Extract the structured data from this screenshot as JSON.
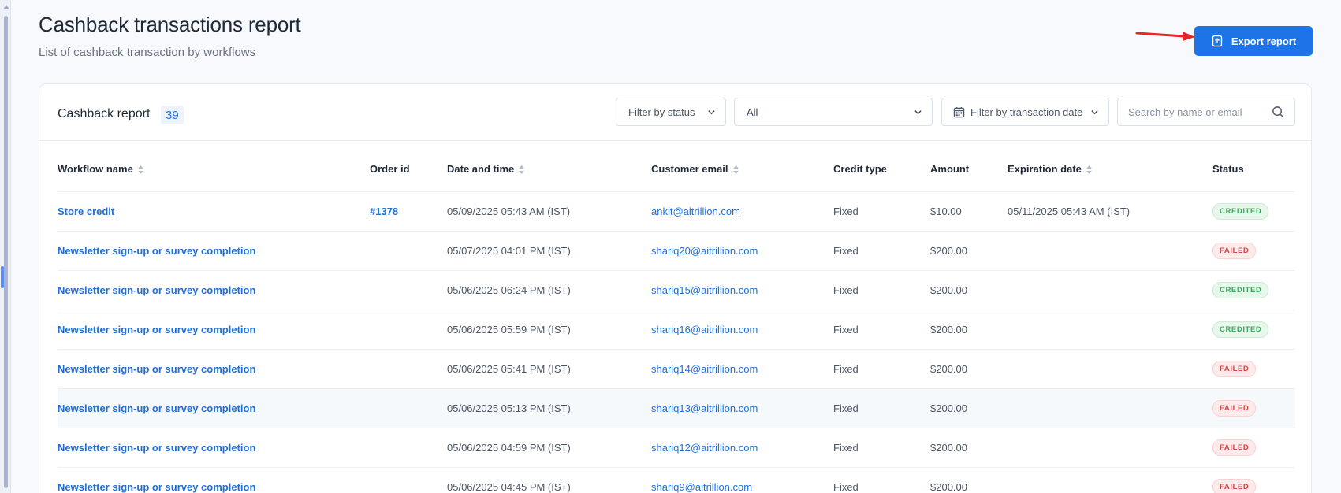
{
  "page": {
    "title": "Cashback transactions report",
    "subtitle": "List of cashback transaction by workflows",
    "export_label": "Export report"
  },
  "report": {
    "title": "Cashback report",
    "count": "39",
    "filters": {
      "status_label": "Filter by status",
      "selected_value": "All",
      "date_label": "Filter by transaction date",
      "search_placeholder": "Search by name or email"
    },
    "columns": [
      "Workflow name",
      "Order id",
      "Date and time",
      "Customer email",
      "Credit type",
      "Amount",
      "Expiration date",
      "Status"
    ],
    "rows": [
      {
        "workflow": "Store credit",
        "order": "#1378",
        "datetime": "05/09/2025 05:43 AM (IST)",
        "email": "ankit@aitrillion.com",
        "credit_type": "Fixed",
        "amount": "$10.00",
        "expiration": "05/11/2025 05:43 AM (IST)",
        "status": "CREDITED"
      },
      {
        "workflow": "Newsletter sign-up or survey completion",
        "order": "",
        "datetime": "05/07/2025 04:01 PM (IST)",
        "email": "shariq20@aitrillion.com",
        "credit_type": "Fixed",
        "amount": "$200.00",
        "expiration": "",
        "status": "FAILED"
      },
      {
        "workflow": "Newsletter sign-up or survey completion",
        "order": "",
        "datetime": "05/06/2025 06:24 PM (IST)",
        "email": "shariq15@aitrillion.com",
        "credit_type": "Fixed",
        "amount": "$200.00",
        "expiration": "",
        "status": "CREDITED"
      },
      {
        "workflow": "Newsletter sign-up or survey completion",
        "order": "",
        "datetime": "05/06/2025 05:59 PM (IST)",
        "email": "shariq16@aitrillion.com",
        "credit_type": "Fixed",
        "amount": "$200.00",
        "expiration": "",
        "status": "CREDITED"
      },
      {
        "workflow": "Newsletter sign-up or survey completion",
        "order": "",
        "datetime": "05/06/2025 05:41 PM (IST)",
        "email": "shariq14@aitrillion.com",
        "credit_type": "Fixed",
        "amount": "$200.00",
        "expiration": "",
        "status": "FAILED"
      },
      {
        "workflow": "Newsletter sign-up or survey completion",
        "order": "",
        "datetime": "05/06/2025 05:13 PM (IST)",
        "email": "shariq13@aitrillion.com",
        "credit_type": "Fixed",
        "amount": "$200.00",
        "expiration": "",
        "status": "FAILED"
      },
      {
        "workflow": "Newsletter sign-up or survey completion",
        "order": "",
        "datetime": "05/06/2025 04:59 PM (IST)",
        "email": "shariq12@aitrillion.com",
        "credit_type": "Fixed",
        "amount": "$200.00",
        "expiration": "",
        "status": "FAILED"
      },
      {
        "workflow": "Newsletter sign-up or survey completion",
        "order": "",
        "datetime": "05/06/2025 04:45 PM (IST)",
        "email": "shariq9@aitrillion.com",
        "credit_type": "Fixed",
        "amount": "$200.00",
        "expiration": "",
        "status": "FAILED"
      }
    ]
  },
  "colors": {
    "accent": "#1e73e8",
    "credited": "#3ea85c",
    "failed": "#d64545",
    "annotation_arrow": "#e3262a"
  },
  "icons": {
    "export": "upload-file-icon",
    "calendar": "calendar-icon",
    "search": "search-icon",
    "dropdown": "chevron-down-icon",
    "sort": "sort-icon"
  }
}
